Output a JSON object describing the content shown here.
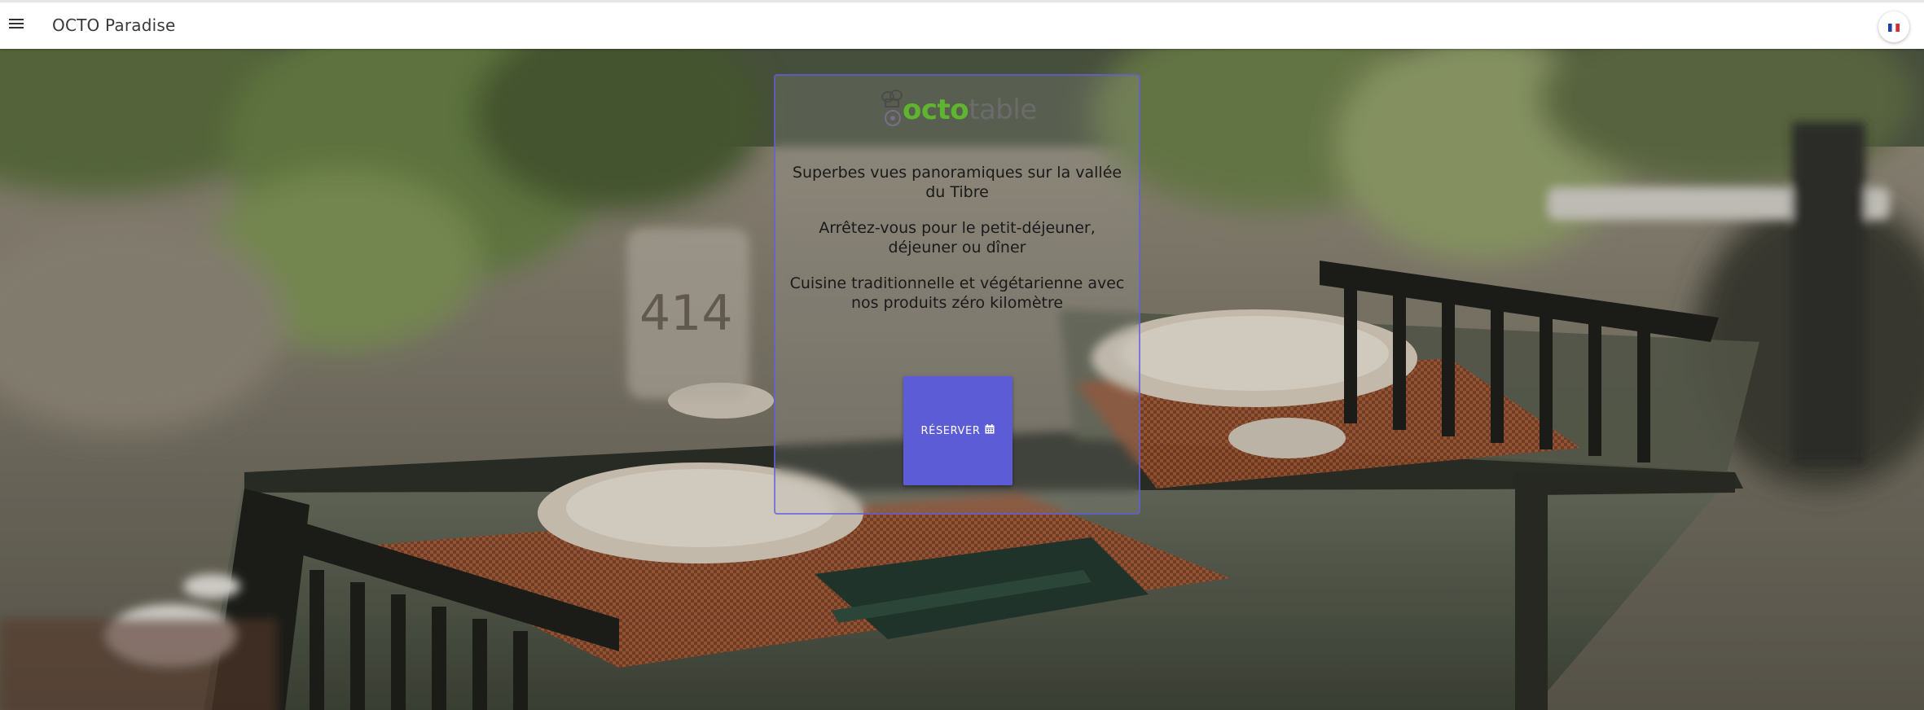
{
  "app": {
    "title": "OCTO Paradise",
    "menu_icon": "hamburger-menu-icon",
    "language_icon": "french-flag-icon"
  },
  "card": {
    "logo": {
      "part1": "octo",
      "part2": "table",
      "icon": "chef-hat-icon",
      "colors": {
        "part1": "#5fb52f",
        "part2": "#6b6b6b"
      }
    },
    "taglines": [
      "Superbes vues panoramiques sur la vallée du Tibre",
      "Arrêtez-vous pour le petit-déjeuner, déjeuner ou dîner",
      "Cuisine traditionnelle et végétarienne avec nos produits zéro kilomètre"
    ],
    "reserve_button": {
      "label": "RÉSERVER",
      "icon": "calendar-icon",
      "color": "#5c5cd6"
    }
  },
  "background": {
    "description_icon": "restaurant-terrace-photo"
  }
}
